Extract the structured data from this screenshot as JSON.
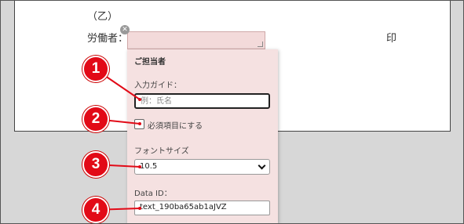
{
  "document": {
    "otsu_label": "（乙）",
    "worker_label": "労働者：",
    "seal_label": "印"
  },
  "panel": {
    "title": "ご担当者",
    "guide_label": "入力ガイド：",
    "guide_placeholder": "例：氏名",
    "required_label": "必須項目にする",
    "required_checked": false,
    "font_size_label": "フォントサイズ",
    "font_size_value": "10.5",
    "data_id_label": "Data ID：",
    "data_id_value": "text_190ba65ab1aJVZ"
  },
  "callouts": [
    "1",
    "2",
    "3",
    "4"
  ],
  "colors": {
    "callout": "#e20a17",
    "panel_bg": "#f5e1e1",
    "field_bg": "#f3dada"
  },
  "icons": {
    "close": "close-icon",
    "resize": "resize-handle-icon",
    "dropdown": "chevron-down-icon"
  }
}
